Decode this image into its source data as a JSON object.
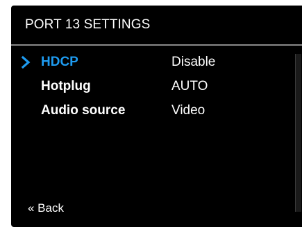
{
  "screen": {
    "title": "PORT 13 SETTINGS"
  },
  "menu": {
    "items": [
      {
        "label": "HDCP",
        "value": "Disable",
        "selected": true
      },
      {
        "label": "Hotplug",
        "value": "AUTO",
        "selected": false
      },
      {
        "label": "Audio source",
        "value": "Video",
        "selected": false
      }
    ]
  },
  "footer": {
    "back_label": "« Back"
  },
  "colors": {
    "background": "#000000",
    "text": "#ffffff",
    "accent": "#1e9bf0",
    "divider": "#8a8a8a"
  },
  "icons": {
    "selection": "chevron-right-icon"
  }
}
